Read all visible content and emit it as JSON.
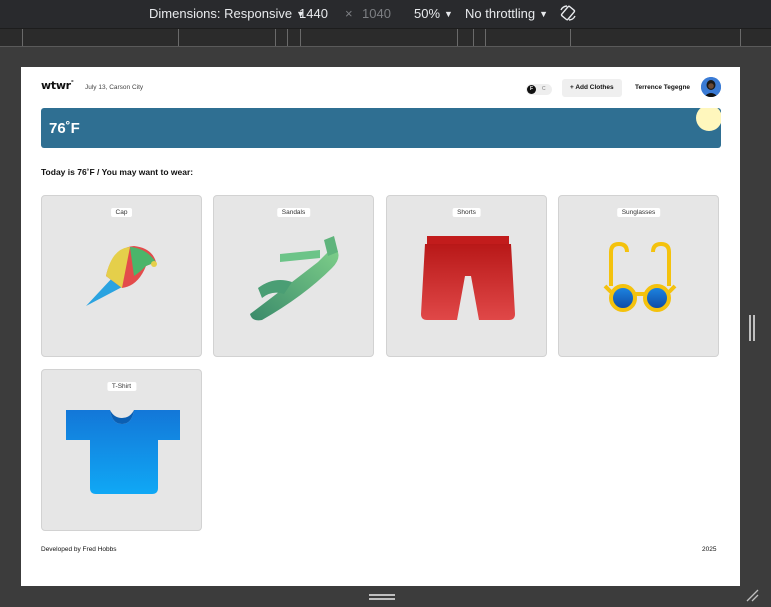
{
  "devtools": {
    "dimensions_label": "Dimensions: Responsive",
    "width": "1440",
    "times": "×",
    "height": "1040",
    "zoom": "50%",
    "throttling": "No throttling"
  },
  "app": {
    "logo": "wtwr",
    "logo_mark": "°",
    "date_location": "July 13, Carson City",
    "toggle_f": "F",
    "toggle_c": "C",
    "add_clothes_label": "+ Add Clothes",
    "user_name": "Terrence Tegegne",
    "weather_temp": "76˚F",
    "recommendation": "Today is 76˚F / You may want to wear:",
    "items": [
      {
        "label": "Cap",
        "icon": "cap-icon"
      },
      {
        "label": "Sandals",
        "icon": "sandals-icon"
      },
      {
        "label": "Shorts",
        "icon": "shorts-icon"
      },
      {
        "label": "Sunglasses",
        "icon": "sunglasses-icon"
      },
      {
        "label": "T-Shirt",
        "icon": "tshirt-icon"
      }
    ],
    "footer_credit": "Developed by Fred Hobbs",
    "footer_year": "2025"
  },
  "colors": {
    "weather_bar": "#2f6f92",
    "sun": "#fff7bd",
    "card_bg": "#e6e6e6"
  }
}
